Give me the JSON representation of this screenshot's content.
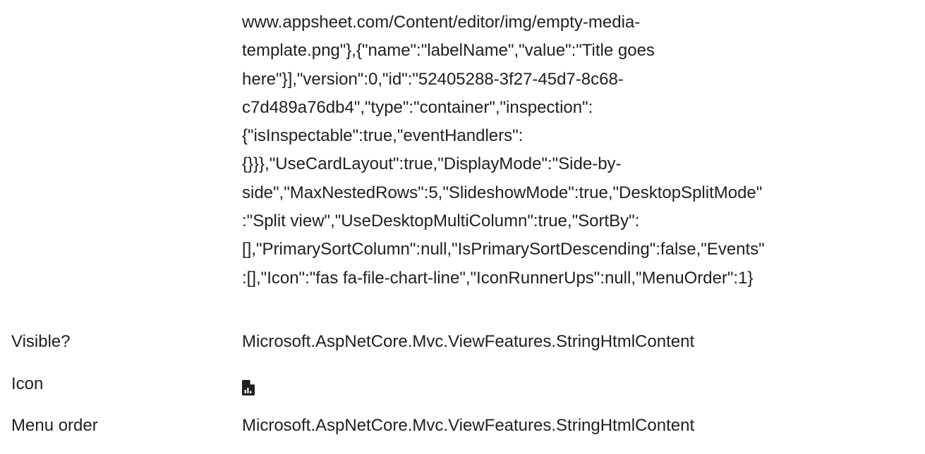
{
  "definition_text": {
    "lines": [
      "www.appsheet.com/Content/editor/img/empty-media-",
      "template.png\"},{\"name\":\"labelName\",\"value\":\"Title goes",
      "here\"}],\"version\":0,\"id\":\"52405288-3f27-45d7-8c68-",
      "c7d489a76db4\",\"type\":\"container\",\"inspection\":",
      "{\"isInspectable\":true,\"eventHandlers\":",
      "{}}},\"UseCardLayout\":true,\"DisplayMode\":\"Side-by-",
      "side\",\"MaxNestedRows\":5,\"SlideshowMode\":true,\"DesktopSplitMode\"",
      ":\"Split view\",\"UseDesktopMultiColumn\":true,\"SortBy\":",
      "[],\"PrimarySortColumn\":null,\"IsPrimarySortDescending\":false,\"Events\"",
      ":[],\"Icon\":\"fas fa-file-chart-line\",\"IconRunnerUps\":null,\"MenuOrder\":1}"
    ]
  },
  "properties": {
    "visible": {
      "label": "Visible?",
      "value": "Microsoft.AspNetCore.Mvc.ViewFeatures.StringHtmlContent"
    },
    "icon": {
      "label": "Icon",
      "icon_name": "file-chart-line-icon"
    },
    "menu_order": {
      "label": "Menu order",
      "value": "Microsoft.AspNetCore.Mvc.ViewFeatures.StringHtmlContent"
    }
  }
}
